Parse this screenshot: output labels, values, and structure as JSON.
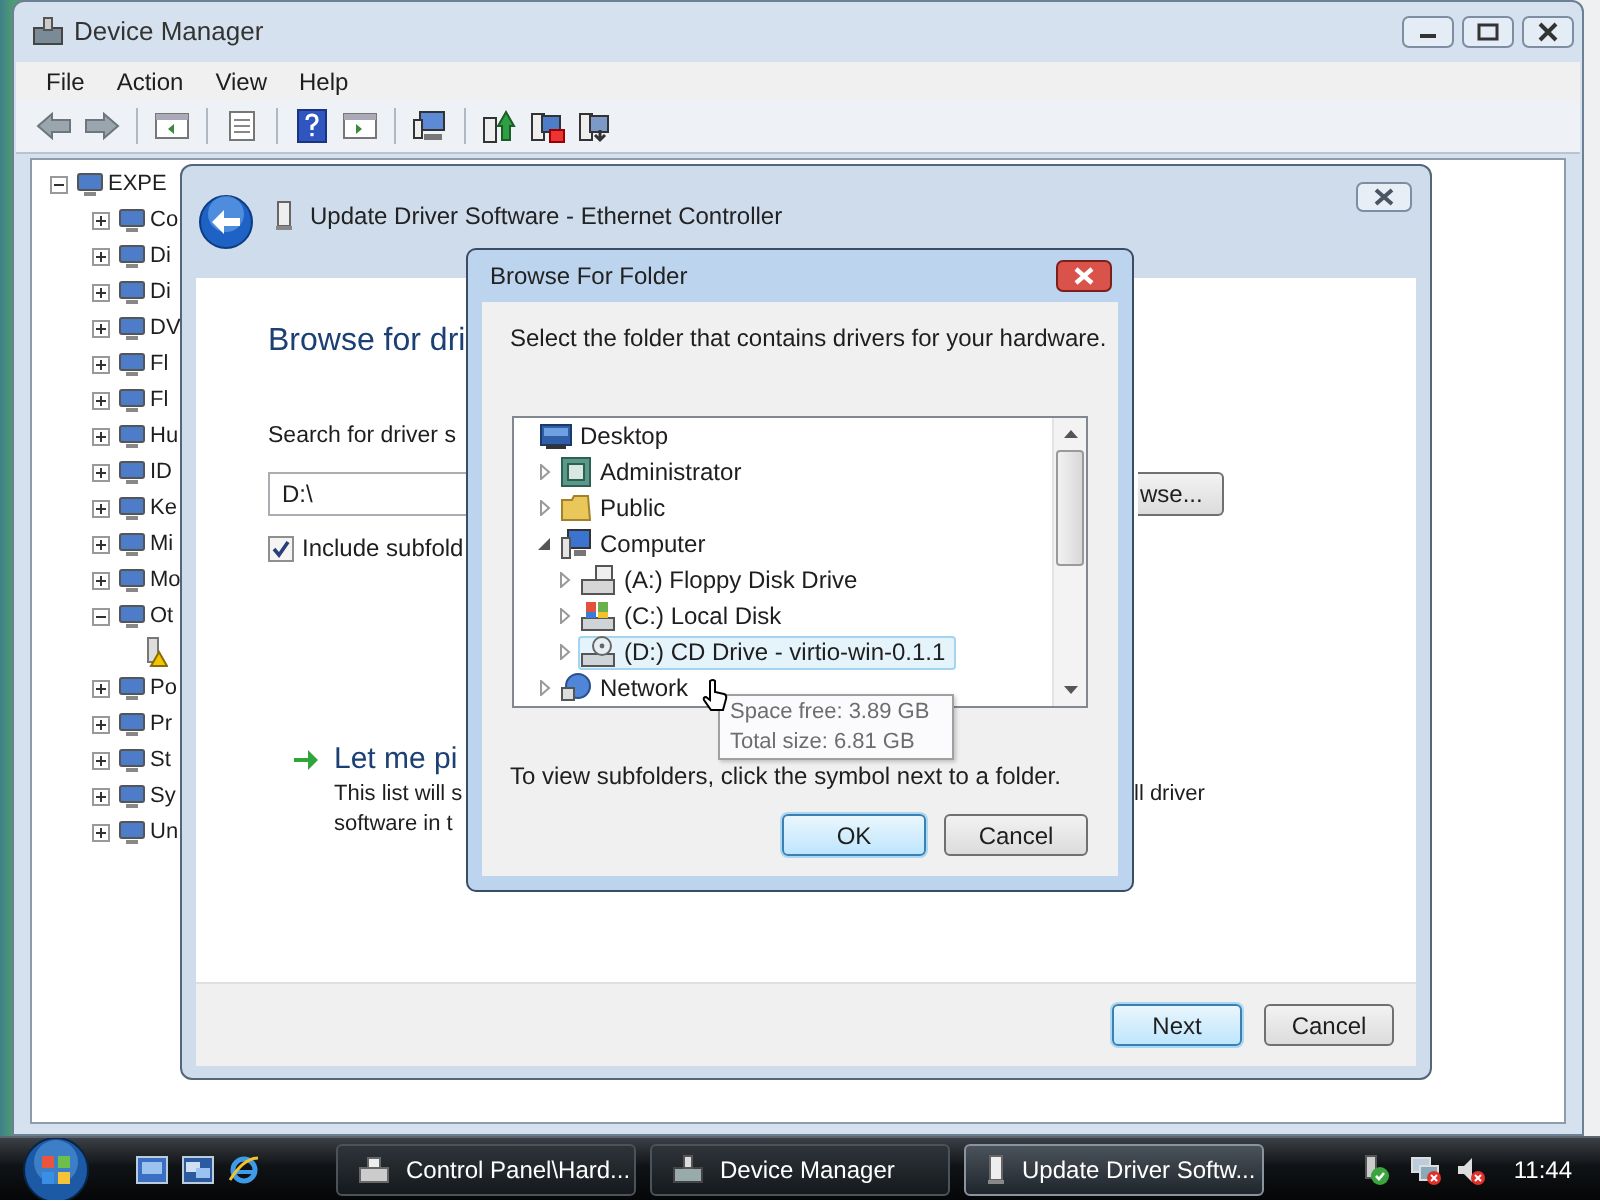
{
  "device_manager": {
    "title": "Device Manager",
    "menu": [
      {
        "label": "File"
      },
      {
        "label": "Action"
      },
      {
        "label": "View"
      },
      {
        "label": "Help"
      }
    ],
    "tree": [
      {
        "label": "EXPE",
        "expanded": true,
        "children": [
          {
            "label": "Co",
            "expanded": false
          },
          {
            "label": "Di",
            "expanded": false
          },
          {
            "label": "Di",
            "expanded": false
          },
          {
            "label": "DV",
            "expanded": false
          },
          {
            "label": "Fl",
            "expanded": false
          },
          {
            "label": "Fl",
            "expanded": false
          },
          {
            "label": "Hu",
            "expanded": false
          },
          {
            "label": "ID",
            "expanded": false
          },
          {
            "label": "Ke",
            "expanded": false
          },
          {
            "label": "Mi",
            "expanded": false
          },
          {
            "label": "Mo",
            "expanded": false
          },
          {
            "label": "Ot",
            "expanded": true,
            "children": [
              {
                "kind": "warning-device"
              }
            ]
          },
          {
            "label": "Po",
            "expanded": false
          },
          {
            "label": "Pr",
            "expanded": false
          },
          {
            "label": "St",
            "expanded": false
          },
          {
            "label": "Sy",
            "expanded": false
          },
          {
            "label": "Un",
            "expanded": false
          }
        ]
      }
    ]
  },
  "update_wizard": {
    "title": "Update Driver Software - Ethernet Controller",
    "heading": "Browse for dri",
    "search_label": "Search for driver s",
    "path_field": {
      "value": "D:\\"
    },
    "browse_button": "wse...",
    "include_subfolders": {
      "label": "Include subfold",
      "checked": true
    },
    "pick_option": {
      "title": "Let me pi",
      "description_left": [
        "This list will s",
        "software in t"
      ],
      "description_right": "ll driver"
    },
    "buttons": [
      {
        "label": "Next",
        "default": true
      },
      {
        "label": "Cancel",
        "default": false
      }
    ]
  },
  "browse_dialog": {
    "title": "Browse For Folder",
    "instruction": "Select the folder that contains drivers for your hardware.",
    "folders": [
      {
        "label": "Desktop",
        "kind": "desktop",
        "selected": false,
        "children": [
          {
            "label": "Administrator",
            "kind": "user",
            "expanded": false,
            "selected": false
          },
          {
            "label": "Public",
            "kind": "folder",
            "expanded": false,
            "selected": false
          },
          {
            "label": "Computer",
            "kind": "computer",
            "expanded": true,
            "selected": false,
            "children": [
              {
                "label": "(A:) Floppy Disk Drive",
                "kind": "floppy",
                "expanded": false,
                "selected": false
              },
              {
                "label": "(C:) Local Disk",
                "kind": "disk",
                "expanded": false,
                "selected": false
              },
              {
                "label": "(D:) CD Drive - virtio-win-0.1.1",
                "kind": "cd",
                "expanded": false,
                "selected": true
              }
            ]
          },
          {
            "label": "Network",
            "kind": "network",
            "expanded": false,
            "selected": false
          }
        ]
      }
    ],
    "tooltip": [
      "Space free: 3.89 GB",
      "Total size: 6.81 GB"
    ],
    "hint": "To view subfolders, click the symbol next to a folder.",
    "buttons": [
      {
        "label": "OK",
        "default": true
      },
      {
        "label": "Cancel",
        "default": false
      }
    ]
  },
  "taskbar": {
    "tasks": [
      {
        "label": "Control Panel\\Hard...",
        "selected": false
      },
      {
        "label": "Device Manager",
        "selected": false
      },
      {
        "label": "Update Driver Softw...",
        "selected": true
      }
    ],
    "clock": "11:44"
  }
}
